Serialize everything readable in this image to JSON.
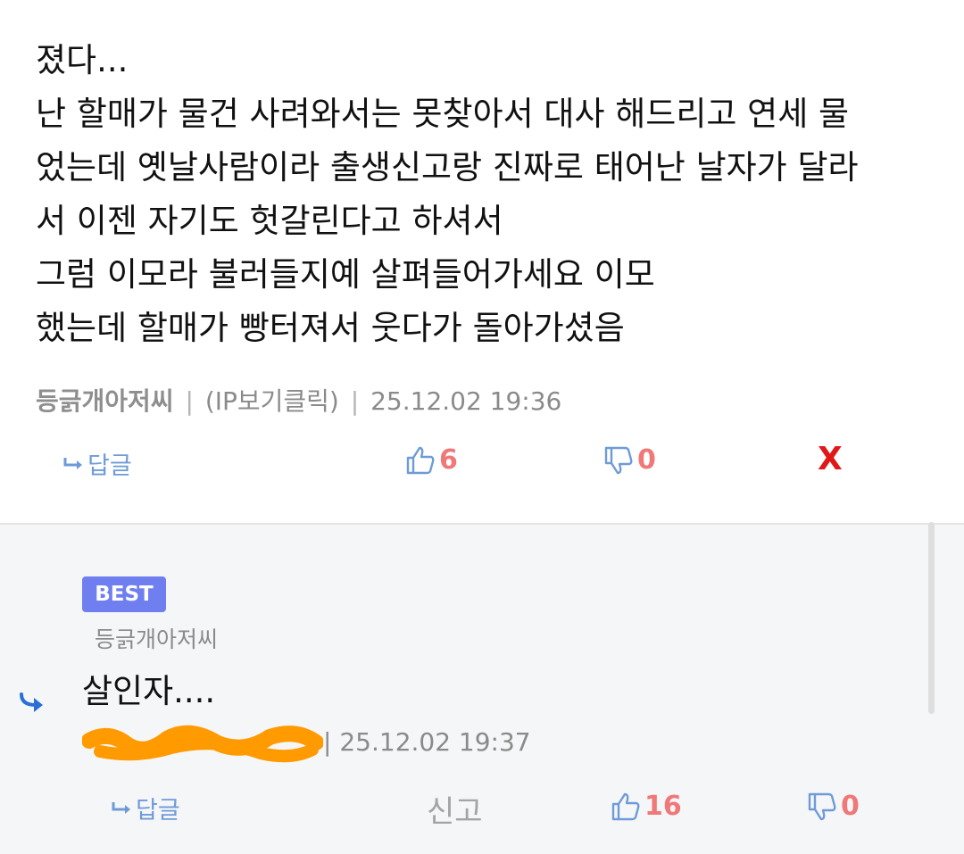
{
  "comment": {
    "lines": [
      "졌다...",
      "난 할매가 물건 사려와서는 못찾아서 대사 해드리고 연세 물",
      "었는데 옛날사람이라 출생신고랑 진짜로 태어난 날자가 달라",
      "서 이젠 자기도 헛갈린다고 하셔서",
      "그럼 이모라 불러들지예 살펴들어가세요 이모",
      "했는데 할매가 빵터져서 웃다가 돌아가셨음"
    ],
    "author": "등긁개아저씨",
    "ip_label": "(IP보기클릭)",
    "separator": "|",
    "timestamp": "25.12.02 19:36",
    "reply_label": "답글",
    "upvotes": "6",
    "downvotes": "0",
    "report_label": "X"
  },
  "best_reply": {
    "badge": "BEST",
    "reply_to": "등긁개아저씨",
    "text": "살인자....",
    "separator": "|",
    "timestamp": "25.12.02 19:37",
    "reply_label": "답글",
    "report_label": "신고",
    "upvotes": "16",
    "downvotes": "0"
  },
  "colors": {
    "vote_count": "#f07878",
    "vote_icon": "#6e9bd8",
    "report_x": "#e01818",
    "best_badge": "#6f7ff0",
    "redaction": "#ff9a00"
  }
}
